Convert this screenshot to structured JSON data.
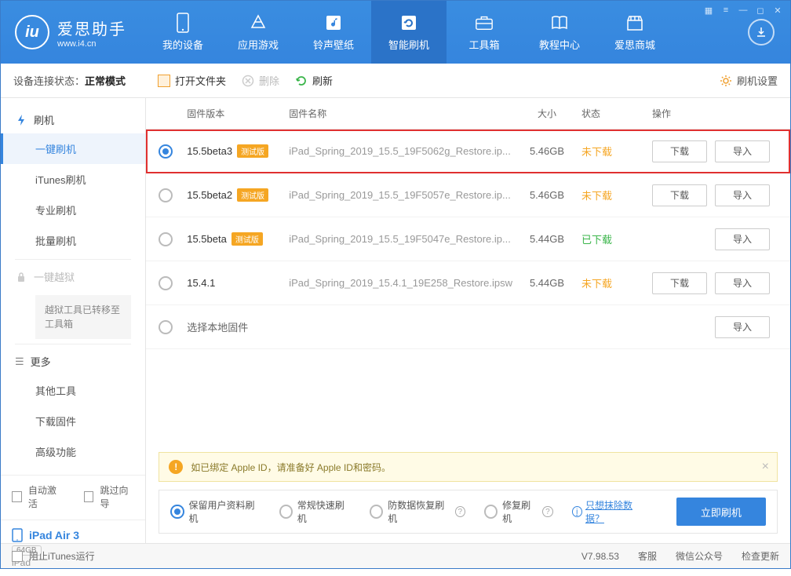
{
  "titlebar": {
    "logo_cn": "爱思助手",
    "logo_en": "www.i4.cn"
  },
  "topnav": [
    {
      "label": "我的设备",
      "icon": "device"
    },
    {
      "label": "应用游戏",
      "icon": "apps"
    },
    {
      "label": "铃声壁纸",
      "icon": "media"
    },
    {
      "label": "智能刷机",
      "icon": "flash"
    },
    {
      "label": "工具箱",
      "icon": "toolbox"
    },
    {
      "label": "教程中心",
      "icon": "book"
    },
    {
      "label": "爱思商城",
      "icon": "store"
    }
  ],
  "status_bar": {
    "label": "设备连接状态：",
    "value": "正常模式"
  },
  "actions": {
    "open_folder": "打开文件夹",
    "delete": "删除",
    "refresh": "刷新",
    "settings": "刷机设置"
  },
  "sidebar": {
    "flash_head": "刷机",
    "items": [
      "一键刷机",
      "iTunes刷机",
      "专业刷机",
      "批量刷机"
    ],
    "jailbreak_head": "一键越狱",
    "jailbreak_note": "越狱工具已转移至工具箱",
    "more_head": "更多",
    "more_items": [
      "其他工具",
      "下载固件",
      "高级功能"
    ],
    "auto_activate": "自动激活",
    "skip_guide": "跳过向导"
  },
  "device": {
    "name": "iPad Air 3",
    "capacity": "64GB",
    "type": "iPad"
  },
  "table": {
    "headers": {
      "version": "固件版本",
      "name": "固件名称",
      "size": "大小",
      "status": "状态",
      "ops": "操作"
    },
    "download_btn": "下载",
    "import_btn": "导入",
    "beta_tag": "测试版",
    "rows": [
      {
        "version": "15.5beta3",
        "beta": true,
        "name": "iPad_Spring_2019_15.5_19F5062g_Restore.ip...",
        "size": "5.46GB",
        "status": "未下载",
        "status_class": "pending",
        "selected": true,
        "highlight": true,
        "show_dl": true
      },
      {
        "version": "15.5beta2",
        "beta": true,
        "name": "iPad_Spring_2019_15.5_19F5057e_Restore.ip...",
        "size": "5.46GB",
        "status": "未下载",
        "status_class": "pending",
        "selected": false,
        "show_dl": true
      },
      {
        "version": "15.5beta",
        "beta": true,
        "name": "iPad_Spring_2019_15.5_19F5047e_Restore.ip...",
        "size": "5.44GB",
        "status": "已下载",
        "status_class": "done",
        "selected": false,
        "show_dl": false
      },
      {
        "version": "15.4.1",
        "beta": false,
        "name": "iPad_Spring_2019_15.4.1_19E258_Restore.ipsw",
        "size": "5.44GB",
        "status": "未下载",
        "status_class": "pending",
        "selected": false,
        "show_dl": true
      }
    ],
    "local_label": "选择本地固件"
  },
  "alert": "如已绑定 Apple ID，请准备好 Apple ID和密码。",
  "flash_options": [
    "保留用户资料刷机",
    "常规快速刷机",
    "防数据恢复刷机",
    "修复刷机"
  ],
  "erase_link": "只想抹除数据？",
  "flash_btn": "立即刷机",
  "footer": {
    "block_itunes": "阻止iTunes运行",
    "version": "V7.98.53",
    "support": "客服",
    "wechat": "微信公众号",
    "update": "检查更新"
  }
}
